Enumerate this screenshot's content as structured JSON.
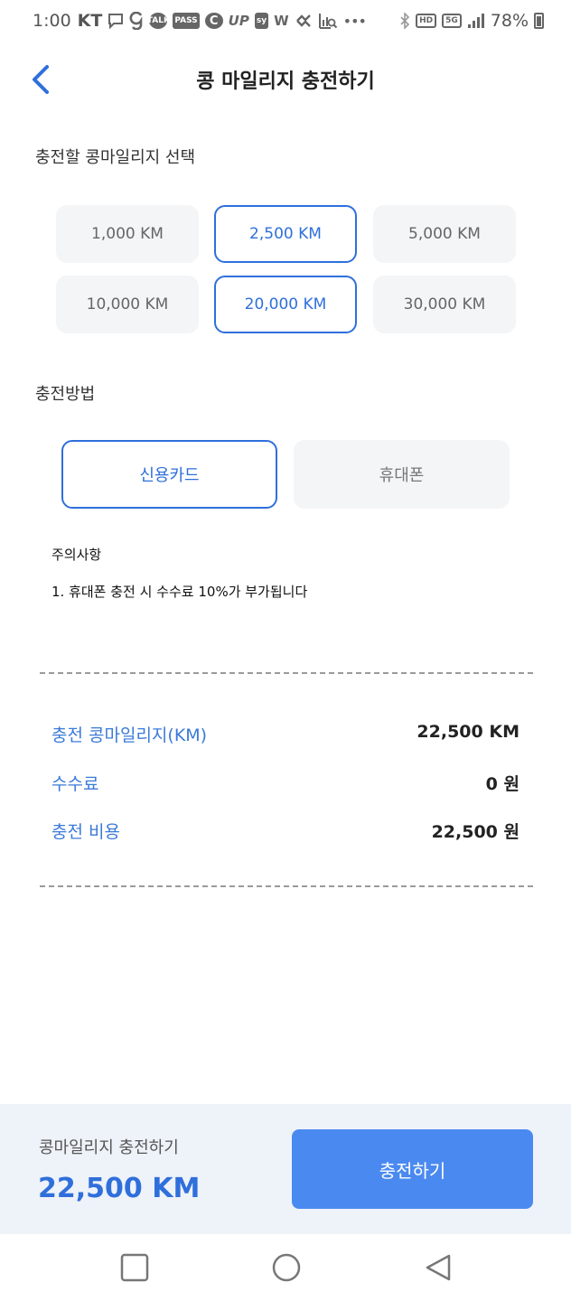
{
  "status_bar": {
    "time": "1:00",
    "carrier": "KT",
    "battery": "78%",
    "icons": [
      "message-icon",
      "g-app-icon",
      "kakaotalk-icon",
      "pass-icon",
      "c-app-icon",
      "up-app-icon",
      "sy-app-icon",
      "w-app-icon",
      "link-app-icon",
      "chart-search-icon",
      "more-dots-icon",
      "bluetooth-icon",
      "hd-icon",
      "5g-icon",
      "signal-icon",
      "battery-icon"
    ],
    "badges": {
      "talk": "TALK",
      "pass": "PASS",
      "up": "UP",
      "sy": "sy",
      "w": "W",
      "hd": "HD",
      "fiveg": "5G",
      "more": "•••"
    }
  },
  "header": {
    "title": "콩 마일리지 충전하기"
  },
  "select_section": {
    "label": "충전할 콩마일리지 선택",
    "options": [
      {
        "label": "1,000 KM",
        "selected": false
      },
      {
        "label": "2,500 KM",
        "selected": true
      },
      {
        "label": "5,000 KM",
        "selected": false
      },
      {
        "label": "10,000 KM",
        "selected": false
      },
      {
        "label": "20,000 KM",
        "selected": true
      },
      {
        "label": "30,000 KM",
        "selected": false
      }
    ]
  },
  "method_section": {
    "label": "충전방법",
    "options": [
      {
        "label": "신용카드",
        "selected": true
      },
      {
        "label": "휴대폰",
        "selected": false
      }
    ]
  },
  "notice": {
    "title": "주의사항",
    "line1": "1. 휴대폰 충전 시 수수료 10%가 부가됩니다"
  },
  "summary": {
    "rows": [
      {
        "label": "충전 콩마일리지(KM)",
        "value": "22,500 KM"
      },
      {
        "label": "수수료",
        "value": "0 원"
      },
      {
        "label": "충전 비용",
        "value": "22,500 원"
      }
    ]
  },
  "footer": {
    "label": "콩마일리지 충전하기",
    "total": "22,500 KM",
    "button": "충전하기"
  },
  "colors": {
    "accent": "#2f6fdb",
    "button": "#4a8af0",
    "chip_bg": "#f4f5f7",
    "footer_bg": "#eef2f9"
  }
}
